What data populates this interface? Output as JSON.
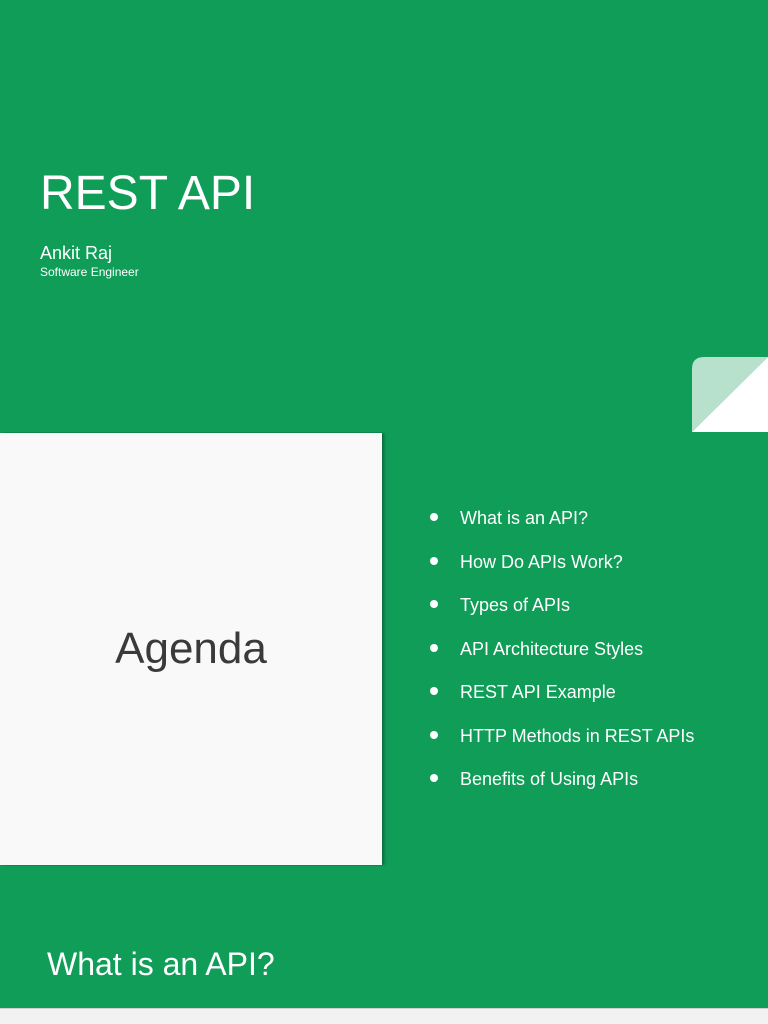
{
  "title_slide": {
    "title": "REST API",
    "author": "Ankit Raj",
    "role": "Software Engineer"
  },
  "agenda_slide": {
    "heading": "Agenda",
    "items": [
      "What is an API?",
      "How Do APIs Work?",
      "Types of APIs",
      "API Architecture Styles",
      "REST API Example",
      "HTTP Methods in REST APIs",
      "Benefits of Using APIs"
    ]
  },
  "next_slide": {
    "title": "What is an API?"
  },
  "colors": {
    "brand_green": "#0f9d58",
    "panel_white": "#f9f9f9",
    "fold_light_green": "#b7e1cd"
  }
}
